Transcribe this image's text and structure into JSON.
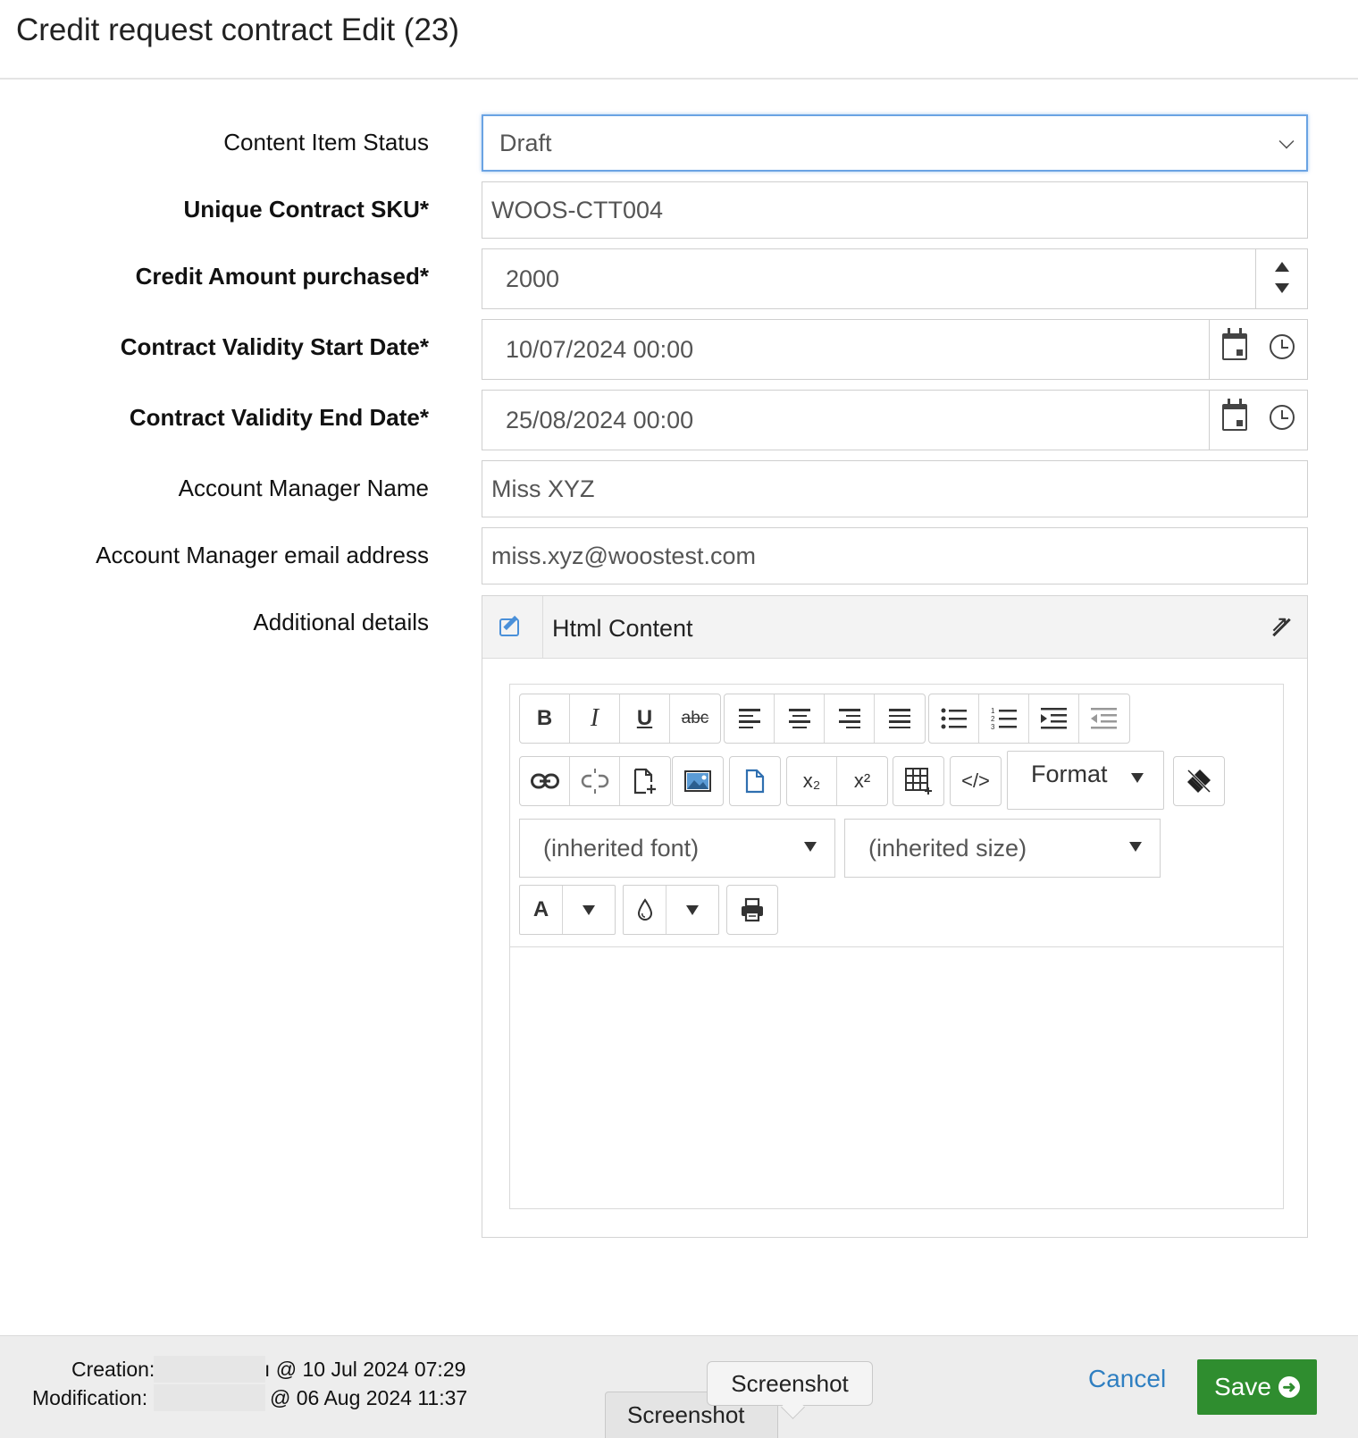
{
  "page": {
    "title": "Credit request contract Edit (23)"
  },
  "form": {
    "status": {
      "label": "Content Item Status",
      "value": "Draft"
    },
    "sku": {
      "label": "Unique Contract SKU*",
      "value": "WOOS-CTT004"
    },
    "credit": {
      "label": "Credit Amount purchased*",
      "value": "2000"
    },
    "start": {
      "label": "Contract Validity Start Date*",
      "value": "10/07/2024 00:00"
    },
    "end": {
      "label": "Contract Validity End Date*",
      "value": "25/08/2024 00:00"
    },
    "manager_name": {
      "label": "Account Manager Name",
      "value": "Miss XYZ"
    },
    "manager_email": {
      "label": "Account Manager email address",
      "value": "miss.xyz@woostest.com"
    },
    "details": {
      "label": "Additional details"
    }
  },
  "editor": {
    "header_title": "Html Content",
    "toolbar": {
      "bold": "B",
      "italic": "I",
      "underline": "U",
      "strike": "abc",
      "subscript": "x₂",
      "superscript": "x²",
      "code": "</>",
      "format_label": "Format",
      "font_select": "(inherited font)",
      "size_select": "(inherited size)",
      "text_color": "A"
    },
    "icons": [
      "bold-icon",
      "italic-icon",
      "underline-icon",
      "strikethrough-icon",
      "align-left-icon",
      "align-center-icon",
      "align-right-icon",
      "align-justify-icon",
      "bullet-list-icon",
      "numbered-list-icon",
      "indent-icon",
      "outdent-icon",
      "link-icon",
      "unlink-icon",
      "new-document-icon",
      "image-icon",
      "document-icon",
      "subscript-icon",
      "superscript-icon",
      "table-icon",
      "code-icon",
      "clear-format-icon",
      "text-color-icon",
      "background-color-icon",
      "print-icon"
    ]
  },
  "footer": {
    "creation_label": "Creation:",
    "creation_value": "ı @ 10 Jul 2024 07:29",
    "modification_label": "Modification:",
    "modification_value": "@ 06 Aug 2024 11:37",
    "cancel": "Cancel",
    "save": "Save",
    "tooltip": "Screenshot",
    "tab": "Screenshot"
  },
  "colors": {
    "accent": "#2f7fc1",
    "save": "#2f8d2f",
    "focus": "#6aa3e3"
  }
}
